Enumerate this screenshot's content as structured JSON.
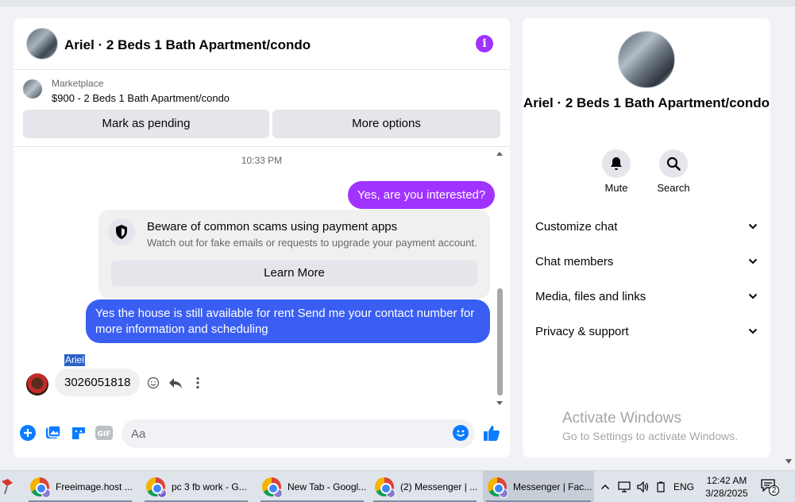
{
  "header": {
    "title": "Ariel · 2 Beds 1 Bath Apartment/condo"
  },
  "marketplace": {
    "label": "Marketplace",
    "item": "$900 - 2 Beds 1 Bath Apartment/condo",
    "pending_label": "Mark as pending",
    "more_label": "More options"
  },
  "conversation": {
    "timestamp": "10:33 PM",
    "out1": "Yes, are you interested?",
    "scam_title": "Beware of common scams using payment apps",
    "scam_subtitle": "Watch out for fake emails or requests to upgrade your payment account.",
    "learn_more": "Learn More",
    "out2": "Yes the house is still available for rent Send me your contact number for more  information and  scheduling",
    "sender_name": "Ariel",
    "in1": "3026051818"
  },
  "composer": {
    "placeholder": "Aa"
  },
  "sidebar": {
    "title": "Ariel · 2 Beds 1 Bath Apartment/condo",
    "mute_label": "Mute",
    "search_label": "Search",
    "sections": [
      "Customize chat",
      "Chat members",
      "Media, files and links",
      "Privacy & support"
    ]
  },
  "watermark": {
    "title": "Activate Windows",
    "subtitle": "Go to Settings to activate Windows."
  },
  "taskbar": {
    "apps": [
      {
        "label": "Freeimage.host ...",
        "profile": ""
      },
      {
        "label": "pc 3 fb work - G...",
        "profile": "P"
      },
      {
        "label": "New Tab - Googl...",
        "profile": ""
      },
      {
        "label": "(2) Messenger | ...",
        "profile": ""
      },
      {
        "label": "Messenger | Fac...",
        "profile": ""
      }
    ],
    "language": "ENG",
    "time": "12:42 AM",
    "date": "3/28/2025",
    "notification_count": "2"
  },
  "colors": {
    "accent_purple": "#a033ff",
    "outgoing_blue": "#3a5ef2",
    "messenger_blue": "#0a7cff"
  }
}
